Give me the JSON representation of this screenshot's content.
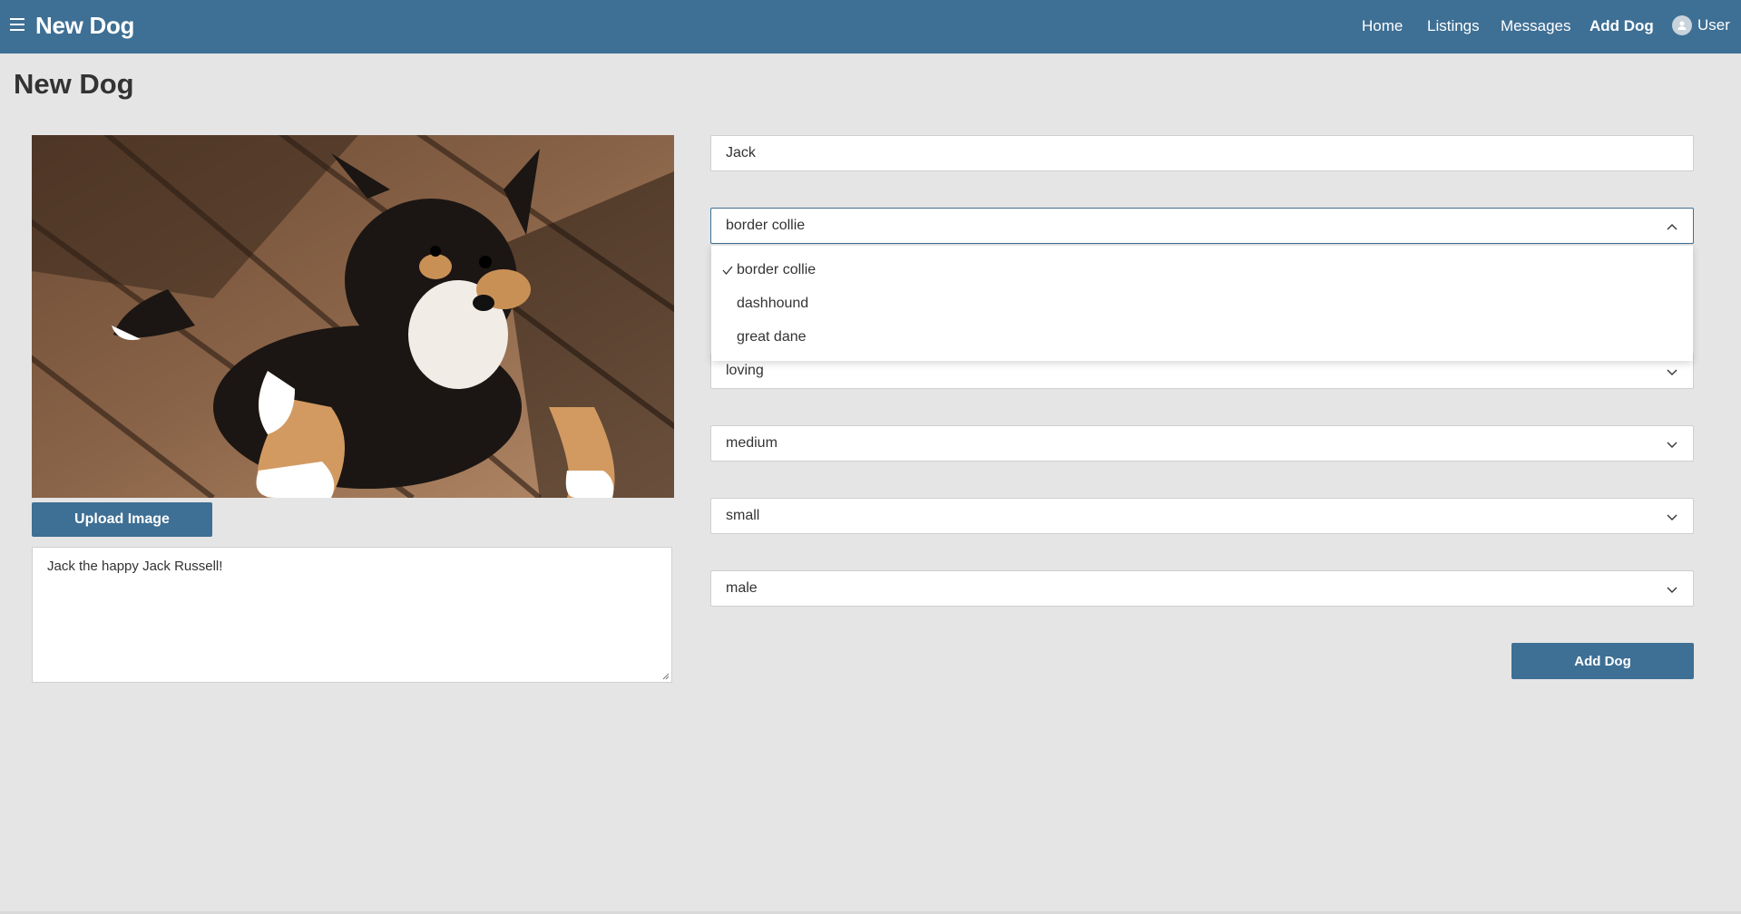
{
  "header": {
    "brand": "New Dog",
    "nav": [
      "Home",
      "Listings",
      "Messages",
      "Add Dog"
    ],
    "active_nav": "Add Dog",
    "user_label": "User"
  },
  "page": {
    "title": "New Dog"
  },
  "left": {
    "image_alt": "puppy lying on wooden deck",
    "upload_label": "Upload Image",
    "description": "Jack the happy Jack Russell!"
  },
  "form": {
    "name_value": "Jack",
    "breed_value": "border collie",
    "breed_options": [
      "border collie",
      "dashhound",
      "great dane"
    ],
    "temperament_value": "loving",
    "energy_value": "medium",
    "size_value": "small",
    "sex_value": "male",
    "submit_label": "Add Dog"
  },
  "colors": {
    "brand": "#3e6f94",
    "background": "#e5e5e5"
  }
}
